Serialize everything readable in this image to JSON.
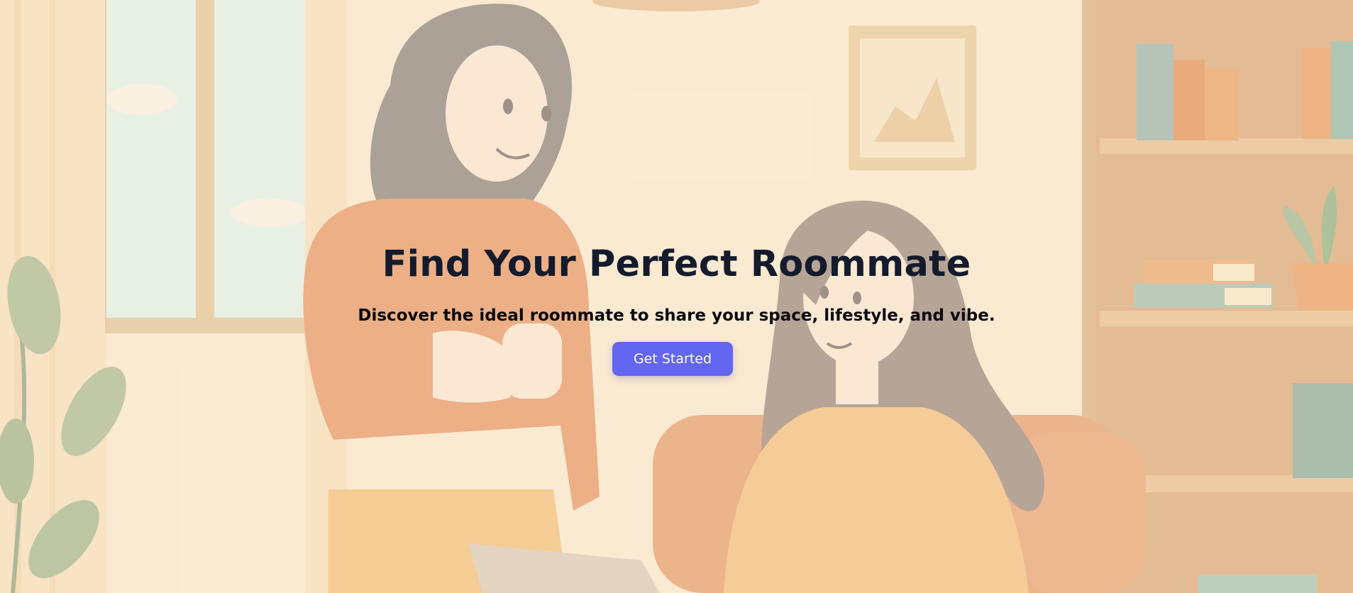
{
  "hero": {
    "title": "Find Your Perfect Roommate",
    "subtitle": "Discover the ideal roommate to share your space, lifestyle, and vibe.",
    "cta_label": "Get Started"
  },
  "colors": {
    "title": "#141b2d",
    "cta_background": "#6366f1",
    "cta_text": "#ffffff",
    "background": "#f7e6c9"
  },
  "illustration": {
    "subject": "two-roommates-living-room"
  }
}
